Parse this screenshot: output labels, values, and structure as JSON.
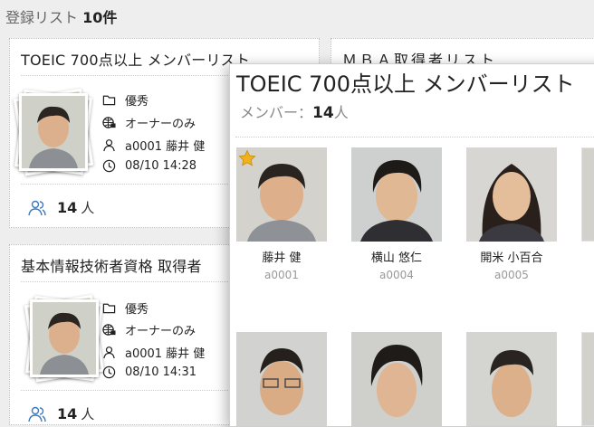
{
  "header": {
    "prefix": "登録リスト",
    "count": "10件"
  },
  "cards": [
    {
      "title": "TOEIC 700点以上 メンバーリスト",
      "folder": "優秀",
      "visibility": "オーナーのみ",
      "owner": "a0001 藤井 健",
      "datetime": "08/10 14:28",
      "member_count": "14",
      "member_unit": "人"
    },
    {
      "title": "ＭＢＡ取得者リスト"
    },
    {
      "title": "基本情報技術者資格 取得者",
      "folder": "優秀",
      "visibility": "オーナーのみ",
      "owner": "a0001 藤井 健",
      "datetime": "08/10 14:31",
      "member_count": "14",
      "member_unit": "人"
    }
  ],
  "popup": {
    "title": "TOEIC 700点以上 メンバーリスト",
    "members_label": "メンバー：",
    "members_count": "14",
    "members_unit": "人",
    "members": [
      {
        "name": "藤井 健",
        "id": "a0001",
        "starred": true
      },
      {
        "name": "横山 悠仁",
        "id": "a0004",
        "starred": false
      },
      {
        "name": "開米 小百合",
        "id": "a0005",
        "starred": false
      }
    ]
  },
  "colors": {
    "accent_blue": "#3a7bbf",
    "star_gold": "#f0b21a"
  }
}
